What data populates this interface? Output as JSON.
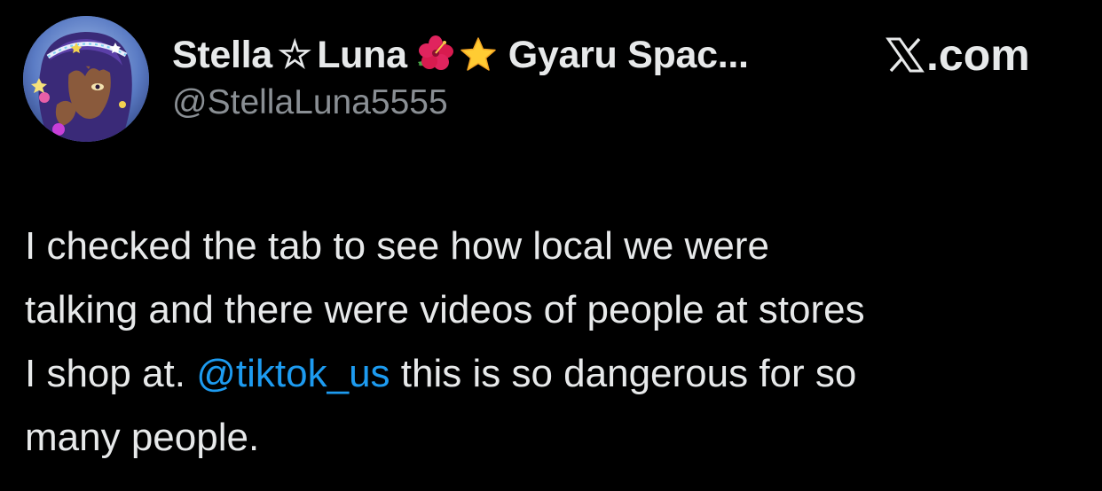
{
  "author": {
    "name_part1": "Stella",
    "name_star": "☆",
    "name_part2": "Luna",
    "name_emoji_1": "hibiscus-emoji",
    "name_emoji_2": "star-emoji",
    "name_part3": "Gyaru Spac...",
    "handle": "@StellaLuna5555",
    "avatar": "anime-character-avatar"
  },
  "source": {
    "logo": "x-logo-icon",
    "label": ".com"
  },
  "tweet": {
    "line1": "I checked the tab to see how local we were",
    "line2": "talking and there were videos of people at stores",
    "line3_before": "I shop at. ",
    "mention": "@tiktok_us",
    "line3_after": " this is so dangerous for so",
    "line4": "many people."
  },
  "colors": {
    "background": "#000000",
    "text": "#e7e9ea",
    "secondary_text": "#8a8f94",
    "link": "#1d9bf0"
  }
}
